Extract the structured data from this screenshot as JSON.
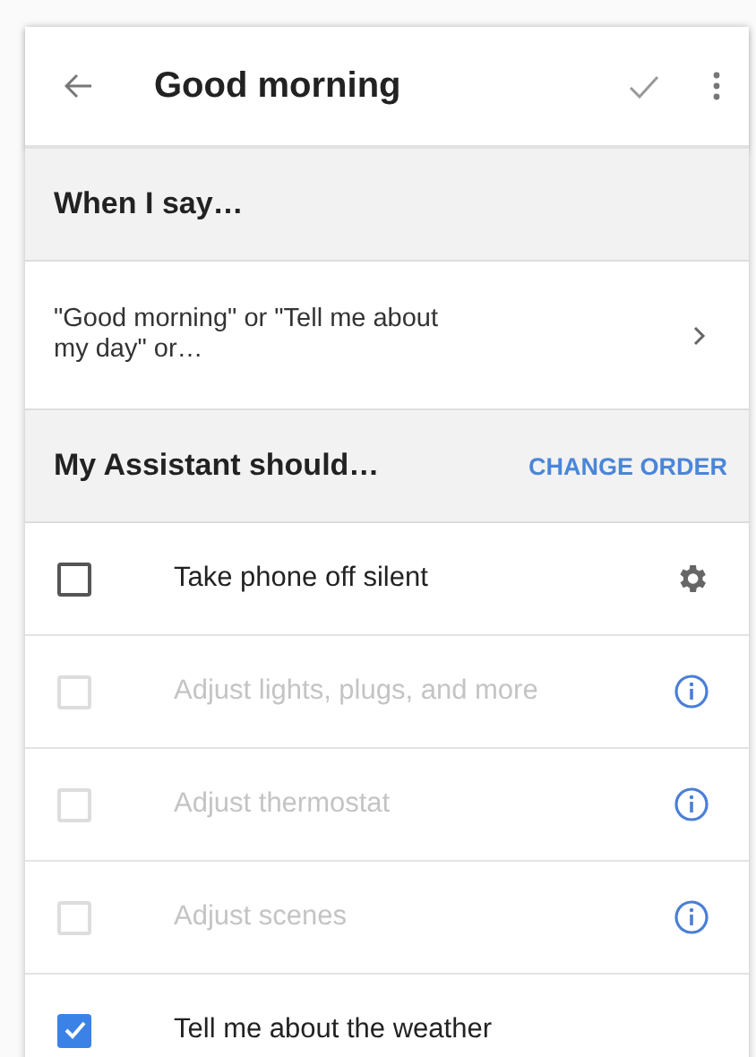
{
  "toolbar": {
    "title": "Good morning"
  },
  "trigger_section": {
    "title": "When I say…",
    "phrase": "\"Good morning\" or \"Tell me about my day\" or…"
  },
  "actions_section": {
    "title": "My Assistant should…",
    "action_button": "CHANGE ORDER"
  },
  "actions": [
    {
      "label": "Take phone off silent",
      "checked": false,
      "disabled": false,
      "kind": "settings"
    },
    {
      "label": "Adjust lights, plugs, and more",
      "checked": false,
      "disabled": true,
      "kind": "info"
    },
    {
      "label": "Adjust thermostat",
      "checked": false,
      "disabled": true,
      "kind": "info"
    },
    {
      "label": "Adjust scenes",
      "checked": false,
      "disabled": true,
      "kind": "info"
    },
    {
      "label": "Tell me about the weather",
      "checked": true,
      "disabled": false,
      "kind": "plain"
    }
  ]
}
